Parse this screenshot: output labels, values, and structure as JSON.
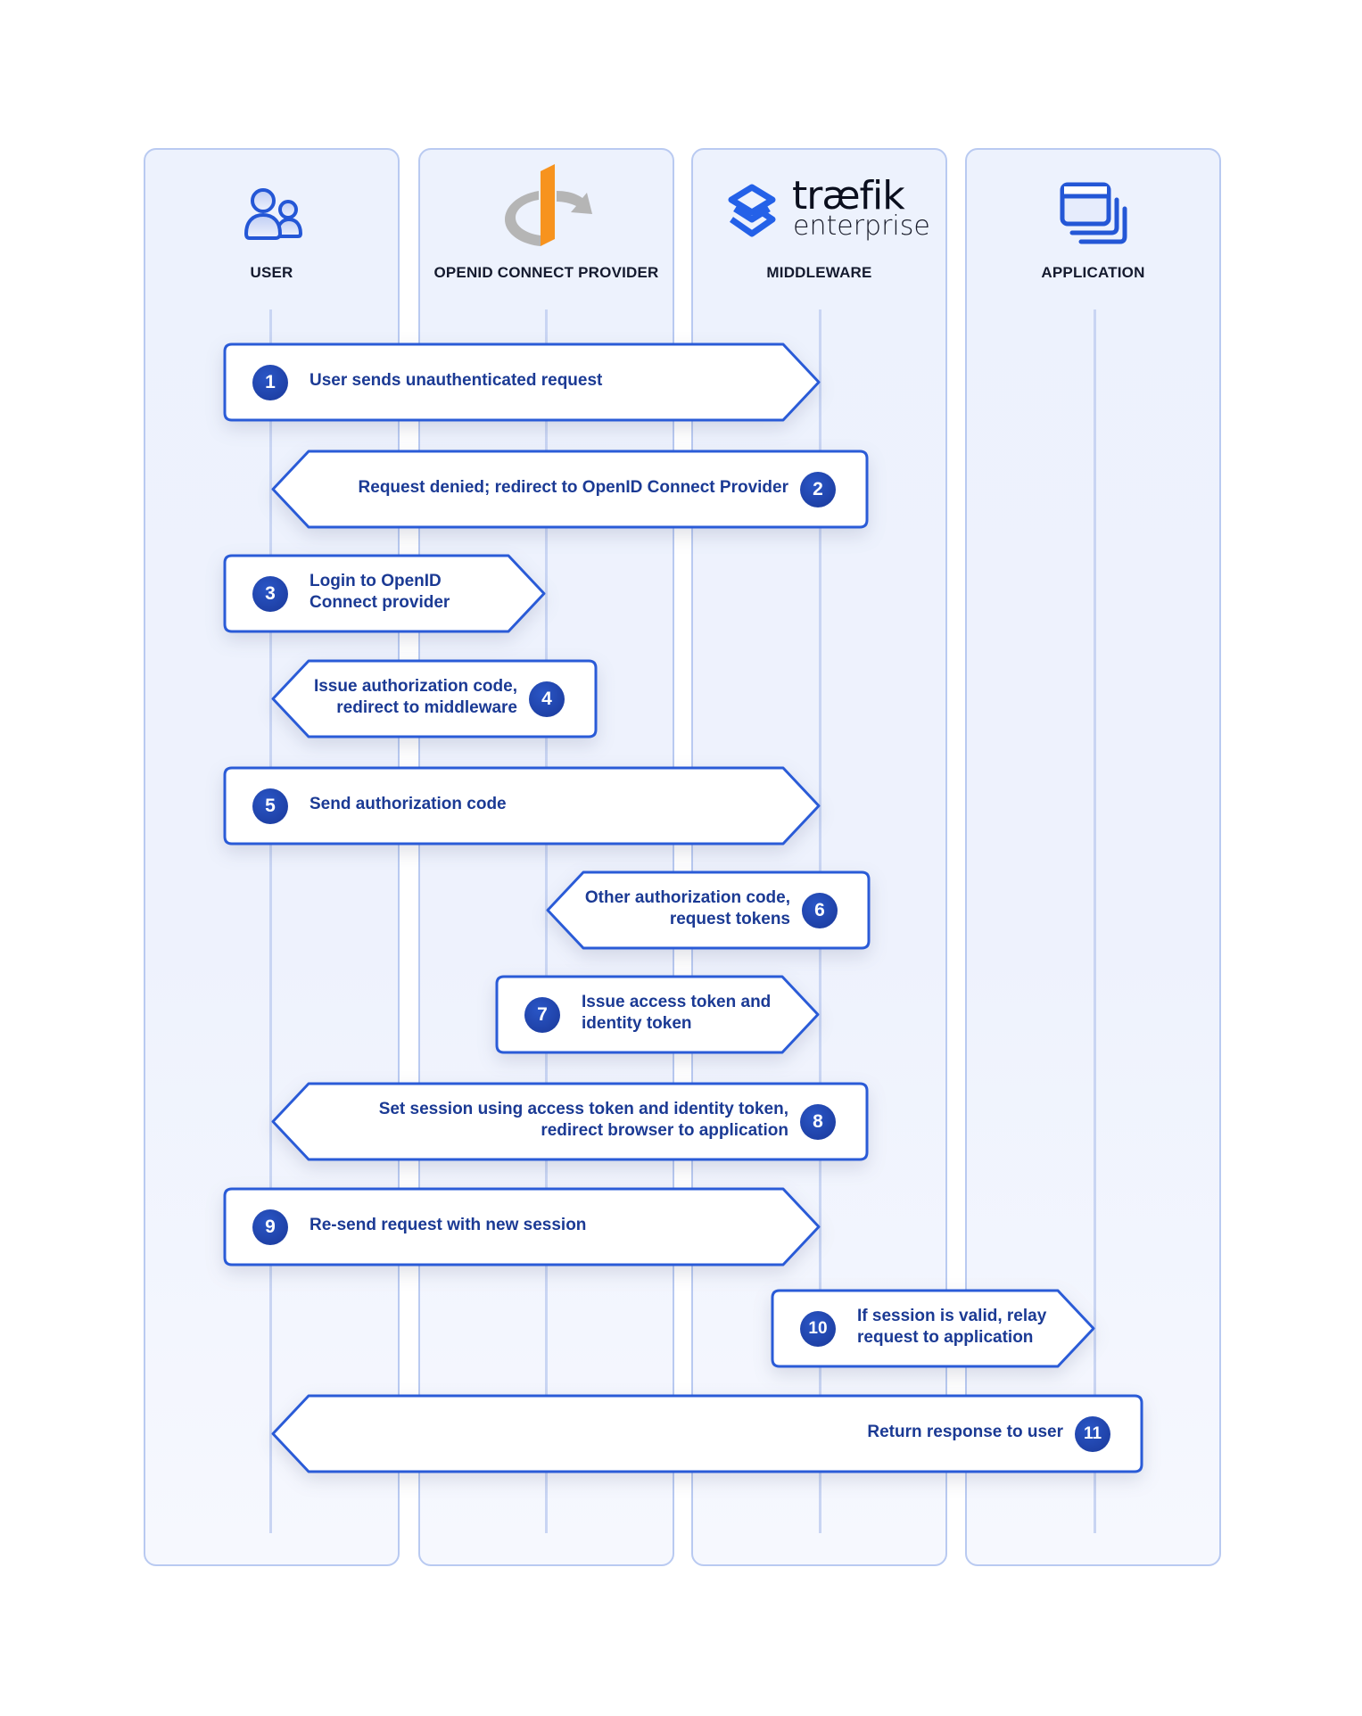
{
  "columns": [
    {
      "label": "USER",
      "icon": "users-icon"
    },
    {
      "label": "OPENID CONNECT PROVIDER",
      "icon": "openid-logo-icon"
    },
    {
      "label": "MIDDLEWARE",
      "icon": "traefik-logo-icon",
      "logo_text": "træfik",
      "logo_subtext": "enterprise"
    },
    {
      "label": "APPLICATION",
      "icon": "application-windows-icon"
    }
  ],
  "colors": {
    "accent": "#2a5bd7",
    "badge": "#1d3fa5",
    "text": "#1b3a94",
    "openid_orange": "#f7931e",
    "openid_gray": "#b3b3b3"
  },
  "steps": [
    {
      "num": "1",
      "lines": [
        "User sends unauthenticated request"
      ],
      "direction": "right"
    },
    {
      "num": "2",
      "lines": [
        "Request denied; redirect to OpenID Connect Provider"
      ],
      "direction": "left"
    },
    {
      "num": "3",
      "lines": [
        "Login to OpenID",
        "Connect provider"
      ],
      "direction": "right"
    },
    {
      "num": "4",
      "lines": [
        "Issue authorization code,",
        "redirect to middleware"
      ],
      "direction": "left"
    },
    {
      "num": "5",
      "lines": [
        "Send authorization code"
      ],
      "direction": "right"
    },
    {
      "num": "6",
      "lines": [
        "Other authorization code,",
        "request tokens"
      ],
      "direction": "left"
    },
    {
      "num": "7",
      "lines": [
        "Issue access token and",
        "identity token"
      ],
      "direction": "right"
    },
    {
      "num": "8",
      "lines": [
        "Set session using access token and identity token,",
        "redirect browser to application"
      ],
      "direction": "left"
    },
    {
      "num": "9",
      "lines": [
        "Re-send request with new session"
      ],
      "direction": "right"
    },
    {
      "num": "10",
      "lines": [
        "If session is valid, relay",
        "request to application"
      ],
      "direction": "right"
    },
    {
      "num": "11",
      "lines": [
        "Return response to user"
      ],
      "direction": "left"
    }
  ]
}
